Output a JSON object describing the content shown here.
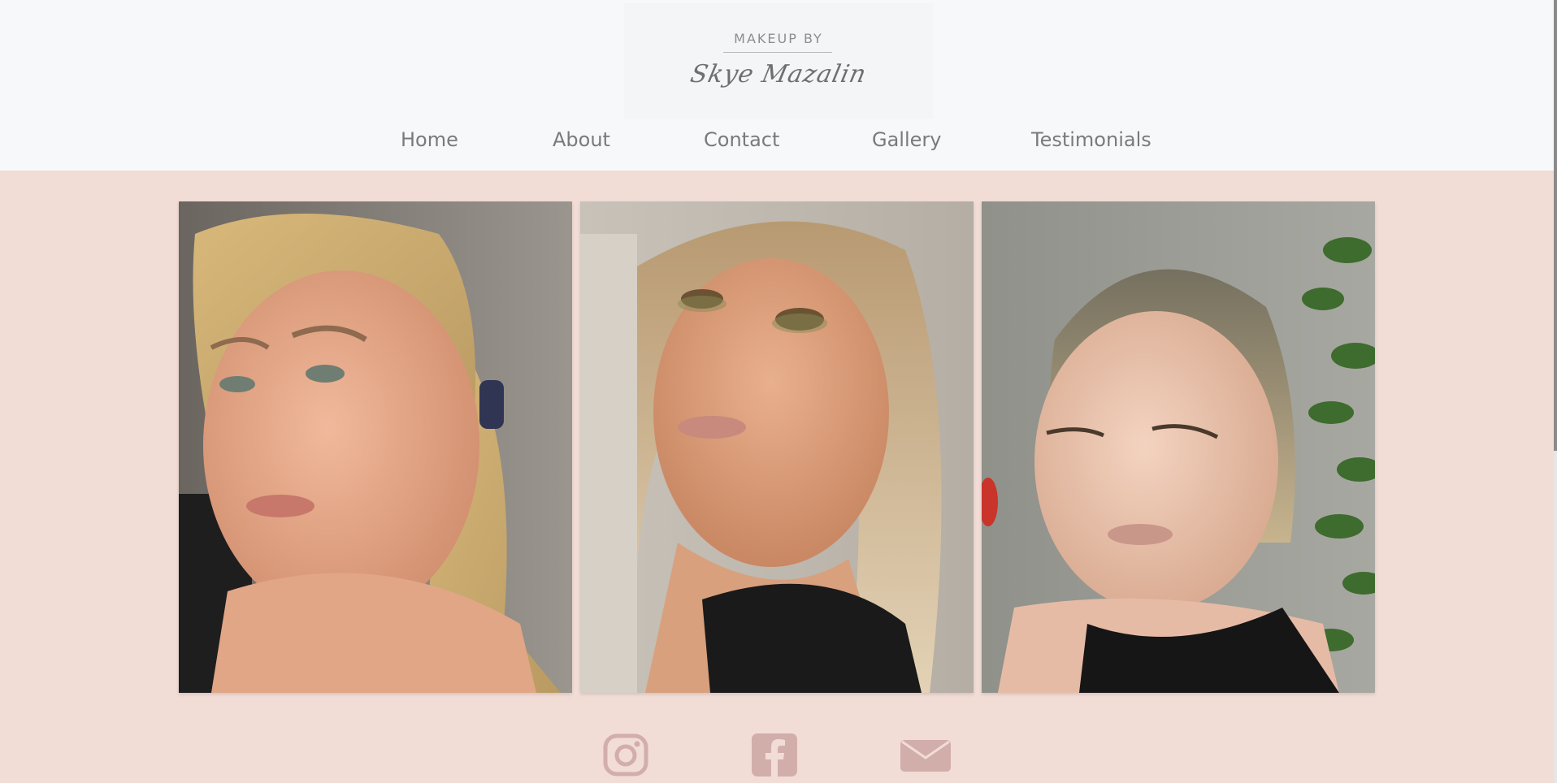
{
  "brand": {
    "tagline": "MAKEUP BY",
    "signature": "Skye Mazalin"
  },
  "nav": {
    "items": [
      {
        "label": "Home"
      },
      {
        "label": "About"
      },
      {
        "label": "Contact"
      },
      {
        "label": "Gallery"
      },
      {
        "label": "Testimonials"
      }
    ]
  },
  "gallery": {
    "photos": [
      {
        "subject": "portrait-blonde-ponytail"
      },
      {
        "subject": "portrait-wavy-hair-green-eyeshadow"
      },
      {
        "subject": "portrait-slicked-back-hair-eyes-closed"
      }
    ]
  },
  "social": {
    "icons": [
      "instagram-icon",
      "facebook-icon",
      "email-icon"
    ]
  },
  "colors": {
    "header_bg": "#f7f8f9",
    "page_bg": "#f2dcd6",
    "accent_icon": "#d2aeaa",
    "nav_text": "#7a7a7a"
  }
}
